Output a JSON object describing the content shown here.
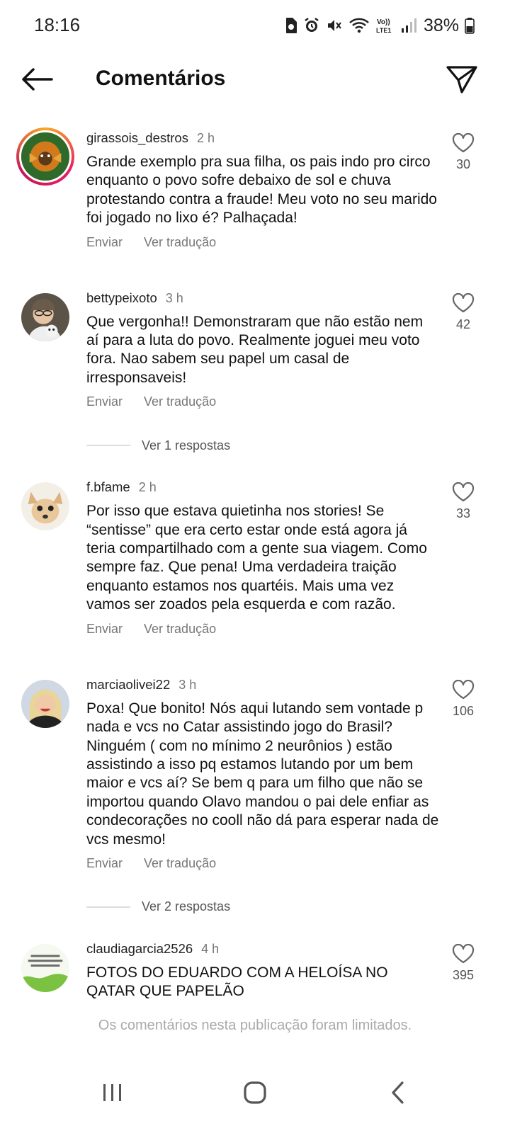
{
  "status_bar": {
    "time": "18:16",
    "battery_percent": "38%",
    "icons": [
      "sim-card-icon",
      "alarm-icon",
      "mute-icon",
      "wifi-icon",
      "volte-lte-icon",
      "signal-icon",
      "battery-icon"
    ]
  },
  "header": {
    "title": "Comentários",
    "back_icon": "arrow-left-icon",
    "share_icon": "send-icon"
  },
  "comments": [
    {
      "username": "girassois_destros",
      "time": "2 h",
      "text": "Grande exemplo pra sua filha, os pais indo pro circo enquanto o povo sofre debaixo de sol e chuva protestando contra a fraude! Meu voto no seu marido foi jogado no lixo é? Palhaçada!",
      "likes": "30",
      "reply_label": "Enviar",
      "translate_label": "Ver tradução"
    },
    {
      "username": "bettypeixoto",
      "time": "3 h",
      "text": "Que vergonha!! Demonstraram que não estão nem aí para a luta do povo. Realmente joguei meu voto fora. Nao sabem seu papel um casal de irresponsaveis!",
      "likes": "42",
      "reply_label": "Enviar",
      "translate_label": "Ver tradução",
      "view_replies": "Ver 1 respostas"
    },
    {
      "username": "f.bfame",
      "time": "2 h",
      "text": "Por isso que estava quietinha nos stories! Se “sentisse” que era certo estar onde está agora já teria compartilhado com a gente sua viagem. Como sempre faz. Que pena! Uma verdadeira traição enquanto estamos nos quartéis. Mais uma vez vamos ser zoados pela esquerda e com razão.",
      "likes": "33",
      "reply_label": "Enviar",
      "translate_label": "Ver tradução"
    },
    {
      "username": "marciaolivei22",
      "time": "3 h",
      "text": "Poxa! Que bonito! Nós aqui lutando sem vontade p nada e vcs no Catar assistindo jogo do Brasil? Ninguém ( com no mínimo 2 neurônios ) estão assistindo a isso pq estamos lutando por um bem maior e vcs aí? Se bem q para um filho que não se importou quando Olavo mandou o pai dele enfiar as condecorações no cooll não dá para esperar nada de vcs mesmo!",
      "likes": "106",
      "reply_label": "Enviar",
      "translate_label": "Ver tradução",
      "view_replies": "Ver 2 respostas"
    },
    {
      "username": "claudiagarcia2526",
      "time": "4 h",
      "text": "FOTOS DO EDUARDO COM A HELOÍSA NO QATAR QUE PAPELÃO",
      "likes": "395"
    }
  ],
  "limited_notice": "Os comentários nesta publicação foram limitados.",
  "nav": {
    "recents_icon": "recents-icon",
    "home_icon": "home-icon",
    "back_icon": "back-icon"
  }
}
